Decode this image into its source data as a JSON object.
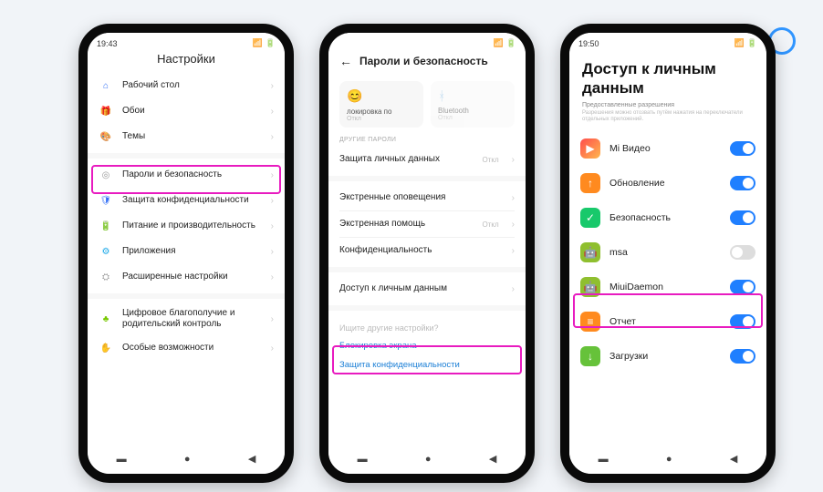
{
  "p1": {
    "status": {
      "time": "19:43"
    },
    "title": "Настройки",
    "items": [
      {
        "label": "Рабочий стол"
      },
      {
        "label": "Обои"
      },
      {
        "label": "Темы"
      },
      {
        "label": "Пароли и безопасность"
      },
      {
        "label": "Защита конфиденциальности"
      },
      {
        "label": "Питание и производительность"
      },
      {
        "label": "Приложения"
      },
      {
        "label": "Расширенные настройки"
      },
      {
        "label": "Цифровое благополучие и родительский контроль"
      },
      {
        "label": "Особые возможности"
      }
    ]
  },
  "p2": {
    "status": {
      "time": ""
    },
    "title": "Пароли и безопасность",
    "cards": [
      {
        "label": "локировка по",
        "sub": "Откл"
      },
      {
        "label": "Bluetooth",
        "sub": "Откл"
      }
    ],
    "section1": "Другие пароли",
    "items": [
      {
        "label": "Защита личных данных",
        "value": "Откл"
      },
      {
        "label": "Экстренные оповещения",
        "value": ""
      },
      {
        "label": "Экстренная помощь",
        "value": "Откл"
      },
      {
        "label": "Конфиденциальность",
        "value": ""
      },
      {
        "label": "Доступ к личным данным",
        "value": ""
      }
    ],
    "searchHint": "Ищите другие настройки?",
    "links": [
      "Блокировка экрана",
      "Защита конфиденциальности"
    ]
  },
  "p3": {
    "status": {
      "time": "19:50"
    },
    "title": "Доступ к личным данным",
    "subhead": "Предоставленные разрешения",
    "subdesc": "Разрешения можно отозвать путём нажатия на переключатели отдельных приложений.",
    "apps": [
      {
        "label": "Mi Видео",
        "on": true
      },
      {
        "label": "Обновление",
        "on": true
      },
      {
        "label": "Безопасность",
        "on": true
      },
      {
        "label": "msa",
        "on": false
      },
      {
        "label": "MiuiDaemon",
        "on": true
      },
      {
        "label": "Отчет",
        "on": true
      },
      {
        "label": "Загрузки",
        "on": true
      }
    ]
  }
}
